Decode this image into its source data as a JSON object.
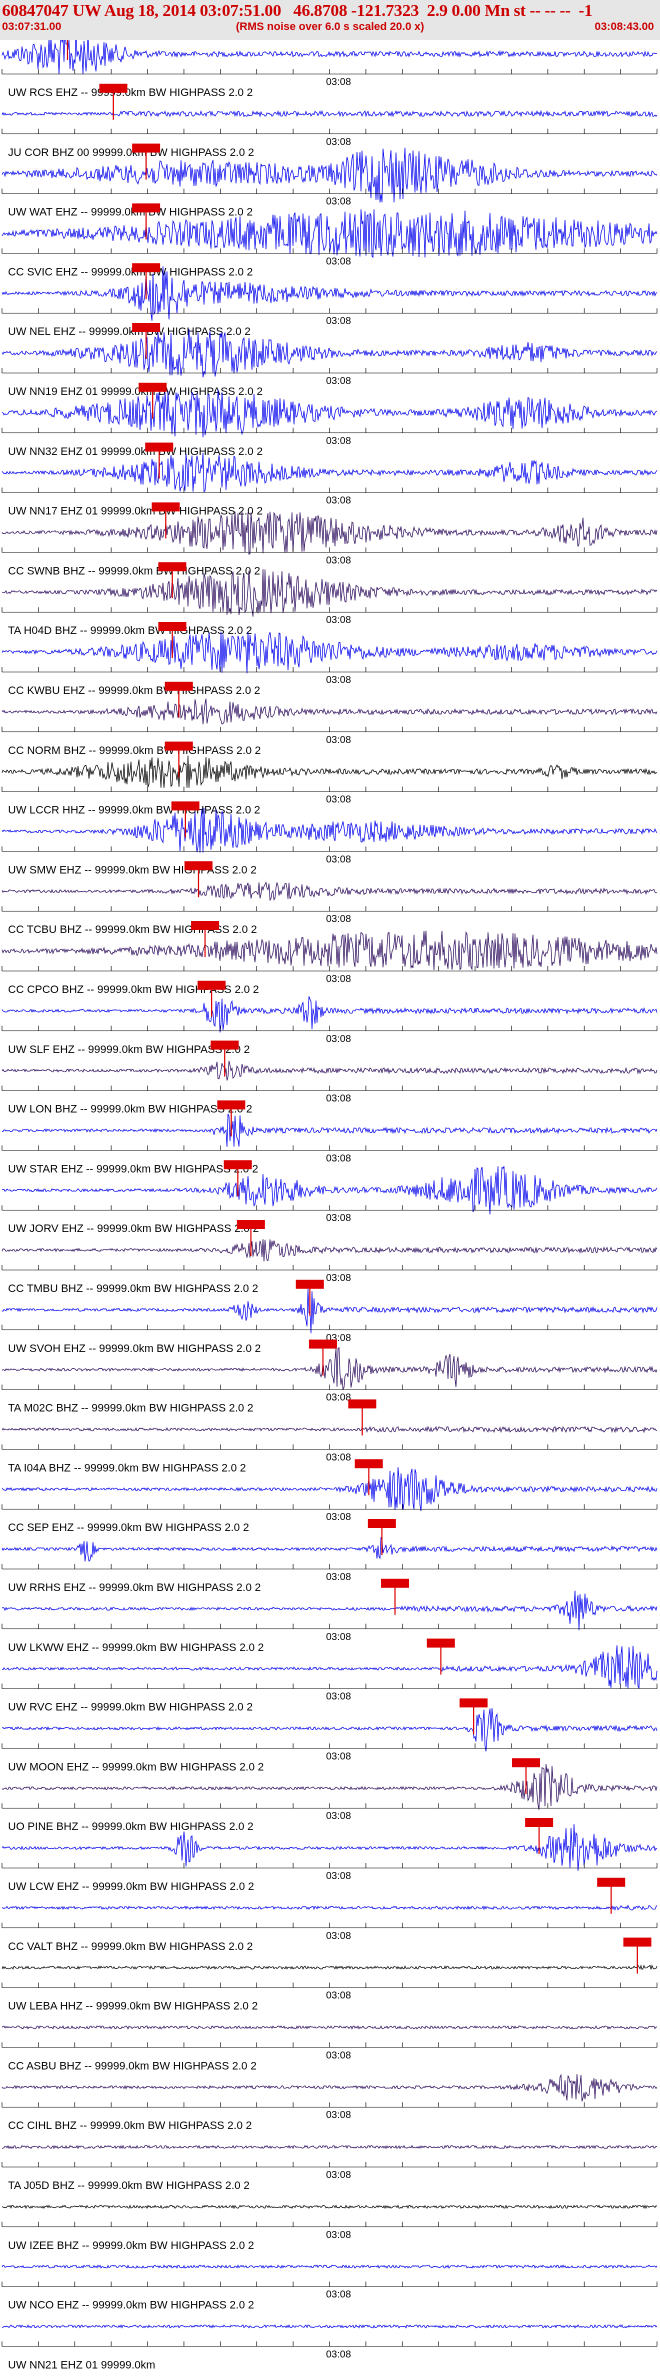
{
  "header": {
    "title": "60847047 UW Aug 18, 2014 03:07:51.00   46.8708 -121.7323  2.9 0.00 Mn st -- -- --  -1",
    "start_time": "03:07:31.00",
    "end_time": "03:08:43.00",
    "note": "(RMS noise over 6.0 s scaled 20.0 x)"
  },
  "colors": {
    "header_bg": "#e6e6e6",
    "title": "#cc0000",
    "trace_blue": "#0000ee",
    "trace_purple": "#2b0b5c",
    "trace_black": "#000000",
    "pick_marker": "#dd0000"
  },
  "chart_data": {
    "type": "seismogram",
    "time_range": [
      "03:07:31.00",
      "03:08:43.00"
    ],
    "center_time_label": "03:08",
    "traces": [
      {
        "label": "UW RCS EHZ -- 99999.0km BW  HIGHPASS  2.0  2",
        "color": "blue",
        "pick": 0.1,
        "bursts": [
          [
            0.1,
            1.0,
            0.07
          ]
        ]
      },
      {
        "label": "JU COR BHZ 00 99999.0km BW  HIGHPASS  2.0  2",
        "color": "blue",
        "pick": 0.17,
        "bursts": []
      },
      {
        "label": "UW WAT EHZ -- 99999.0km BW  HIGHPASS  2.0  2",
        "color": "blue",
        "pick": 0.22,
        "bursts": [
          [
            0.3,
            0.5,
            0.2
          ],
          [
            0.58,
            1.0,
            0.06
          ],
          [
            0.68,
            0.6,
            0.1
          ]
        ]
      },
      {
        "label": "CC SVIC EHZ -- 99999.0km BW  HIGHPASS  2.0  2",
        "color": "blue",
        "pick": 0.22,
        "bursts": [
          [
            0.6,
            1.0,
            0.38
          ]
        ]
      },
      {
        "label": "UW NEL EHZ -- 99999.0km BW  HIGHPASS  2.0  2",
        "color": "blue",
        "pick": 0.22,
        "bursts": [
          [
            0.24,
            1.0,
            0.04
          ],
          [
            0.35,
            0.4,
            0.15
          ]
        ]
      },
      {
        "label": "UW NN19 EHZ 01 99999.0km BW  HIGHPASS  2.0  2",
        "color": "blue",
        "pick": 0.22,
        "bursts": [
          [
            0.3,
            1.0,
            0.14
          ],
          [
            0.8,
            0.4,
            0.06
          ]
        ]
      },
      {
        "label": "UW NN32 EHZ 01 99999.0km BW  HIGHPASS  2.0  2",
        "color": "blue",
        "pick": 0.23,
        "bursts": [
          [
            0.3,
            1.0,
            0.16
          ],
          [
            0.8,
            0.7,
            0.08
          ]
        ]
      },
      {
        "label": "UW NN17 EHZ 01 99999.0km BW  HIGHPASS  2.0  2",
        "color": "blue",
        "pick": 0.24,
        "bursts": [
          [
            0.3,
            0.8,
            0.12
          ],
          [
            0.8,
            0.5,
            0.05
          ]
        ]
      },
      {
        "label": "CC SWNB BHZ -- 99999.0km BW  HIGHPASS  2.0  2",
        "color": "purple",
        "pick": 0.25,
        "bursts": [
          [
            0.4,
            0.9,
            0.16
          ],
          [
            0.88,
            0.6,
            0.04
          ]
        ]
      },
      {
        "label": "TA H04D BHZ -- 99999.0km BW  HIGHPASS  2.0  2",
        "color": "purple",
        "pick": 0.26,
        "bursts": [
          [
            0.38,
            1.0,
            0.14
          ]
        ]
      },
      {
        "label": "CC KWBU EHZ -- 99999.0km BW  HIGHPASS  2.0  2",
        "color": "blue",
        "pick": 0.26,
        "bursts": [
          [
            0.36,
            0.9,
            0.16
          ],
          [
            0.8,
            0.3,
            0.1
          ]
        ]
      },
      {
        "label": "CC NORM BHZ -- 99999.0km BW  HIGHPASS  2.0  2",
        "color": "purple",
        "pick": 0.27,
        "bursts": [
          [
            0.3,
            0.5,
            0.1
          ]
        ]
      },
      {
        "label": "UW LCCR HHZ -- 99999.0km BW  HIGHPASS  2.0  2",
        "color": "black",
        "pick": 0.27,
        "bursts": [
          [
            0.25,
            0.7,
            0.12
          ],
          [
            0.85,
            0.25,
            0.02
          ]
        ]
      },
      {
        "label": "UW SMW EHZ -- 99999.0km BW  HIGHPASS  2.0  2",
        "color": "blue",
        "pick": 0.28,
        "bursts": [
          [
            0.3,
            1.0,
            0.08
          ],
          [
            0.55,
            0.4,
            0.12
          ]
        ]
      },
      {
        "label": "CC TCBU BHZ -- 99999.0km BW  HIGHPASS  2.0  2",
        "color": "purple",
        "pick": 0.3,
        "bursts": [
          [
            0.4,
            0.3,
            0.1
          ]
        ]
      },
      {
        "label": "CC CPCO BHZ -- 99999.0km BW  HIGHPASS  2.0  2",
        "color": "purple",
        "pick": 0.31,
        "bursts": [
          [
            0.65,
            0.8,
            0.34
          ]
        ]
      },
      {
        "label": "UW SLF EHZ -- 99999.0km BW  HIGHPASS  2.0  2",
        "color": "blue",
        "pick": 0.32,
        "bursts": [
          [
            0.33,
            1.0,
            0.02
          ],
          [
            0.47,
            0.8,
            0.015
          ]
        ]
      },
      {
        "label": "UW LON BHZ -- 99999.0km BW  HIGHPASS  2.0  2",
        "color": "purple",
        "pick": 0.34,
        "bursts": [
          [
            0.34,
            0.4,
            0.03
          ]
        ]
      },
      {
        "label": "UW STAR EHZ -- 99999.0km BW  HIGHPASS  2.0  2",
        "color": "blue",
        "pick": 0.35,
        "bursts": [
          [
            0.35,
            0.9,
            0.02
          ]
        ]
      },
      {
        "label": "UW JORV EHZ -- 99999.0km BW  HIGHPASS  2.0  2",
        "color": "blue",
        "pick": 0.36,
        "bursts": [
          [
            0.4,
            0.7,
            0.06
          ],
          [
            0.75,
            1.0,
            0.09
          ]
        ]
      },
      {
        "label": "CC TMBU BHZ -- 99999.0km BW  HIGHPASS  2.0  2",
        "color": "purple",
        "pick": 0.38,
        "bursts": [
          [
            0.4,
            0.4,
            0.05
          ]
        ]
      },
      {
        "label": "UW SVOH EHZ -- 99999.0km BW  HIGHPASS  2.0  2",
        "color": "blue",
        "pick": 0.47,
        "bursts": [
          [
            0.37,
            0.5,
            0.015
          ],
          [
            0.47,
            1.0,
            0.012
          ]
        ]
      },
      {
        "label": "TA M02C BHZ -- 99999.0km BW  HIGHPASS  2.0  2",
        "color": "purple",
        "pick": 0.49,
        "bursts": [
          [
            0.52,
            1.0,
            0.03
          ],
          [
            0.69,
            0.7,
            0.025
          ]
        ]
      },
      {
        "label": "TA I04A BHZ -- 99999.0km BW  HIGHPASS  2.0  2",
        "color": "purple",
        "pick": 0.55,
        "bursts": []
      },
      {
        "label": "CC SEP EHZ -- 99999.0km BW  HIGHPASS  2.0  2",
        "color": "blue",
        "pick": 0.56,
        "bursts": [
          [
            0.62,
            1.0,
            0.06
          ]
        ]
      },
      {
        "label": "UW RRHS EHZ -- 99999.0km BW  HIGHPASS  2.0  2",
        "color": "blue",
        "pick": 0.58,
        "bursts": [
          [
            0.13,
            0.6,
            0.01
          ],
          [
            0.58,
            0.6,
            0.015
          ]
        ]
      },
      {
        "label": "UW LKWW EHZ -- 99999.0km BW  HIGHPASS  2.0  2",
        "color": "blue",
        "pick": 0.6,
        "bursts": [
          [
            0.88,
            0.9,
            0.02
          ]
        ]
      },
      {
        "label": "UW RVC EHZ -- 99999.0km BW  HIGHPASS  2.0  2",
        "color": "blue",
        "pick": 0.67,
        "bursts": [
          [
            0.95,
            1.0,
            0.05
          ]
        ]
      },
      {
        "label": "UW MOON EHZ -- 99999.0km BW  HIGHPASS  2.0  2",
        "color": "blue",
        "pick": 0.72,
        "bursts": [
          [
            0.74,
            1.0,
            0.02
          ]
        ]
      },
      {
        "label": "UO PINE BHZ -- 99999.0km BW  HIGHPASS  2.0  2",
        "color": "purple",
        "pick": 0.8,
        "bursts": [
          [
            0.83,
            1.0,
            0.04
          ]
        ]
      },
      {
        "label": "UW LCW EHZ -- 99999.0km BW  HIGHPASS  2.0  2",
        "color": "blue",
        "pick": 0.82,
        "bursts": [
          [
            0.28,
            0.8,
            0.015
          ],
          [
            0.88,
            1.0,
            0.05
          ]
        ]
      },
      {
        "label": "CC VALT BHZ -- 99999.0km BW  HIGHPASS  2.0  2",
        "color": "blue",
        "pick": 0.93,
        "bursts": []
      },
      {
        "label": "UW LEBA HHZ -- 99999.0km BW  HIGHPASS  2.0  2",
        "color": "black",
        "pick": 0.97,
        "bursts": []
      },
      {
        "label": "CC ASBU BHZ -- 99999.0km BW  HIGHPASS  2.0  2",
        "color": "purple",
        "pick": null,
        "bursts": []
      },
      {
        "label": "CC CIHL BHZ -- 99999.0km BW  HIGHPASS  2.0  2",
        "color": "purple",
        "pick": null,
        "bursts": [
          [
            0.88,
            0.6,
            0.06
          ]
        ]
      },
      {
        "label": "TA J05D BHZ -- 99999.0km BW  HIGHPASS  2.0  2",
        "color": "purple",
        "pick": null,
        "bursts": []
      },
      {
        "label": "UW IZEE BHZ -- 99999.0km BW  HIGHPASS  2.0  2",
        "color": "black",
        "pick": null,
        "bursts": []
      },
      {
        "label": "UW NCO EHZ -- 99999.0km BW  HIGHPASS  2.0  2",
        "color": "blue",
        "pick": null,
        "bursts": []
      },
      {
        "label": "UW NN21 EHZ 01 99999.0km",
        "color": "blue",
        "pick": null,
        "bursts": []
      }
    ]
  }
}
